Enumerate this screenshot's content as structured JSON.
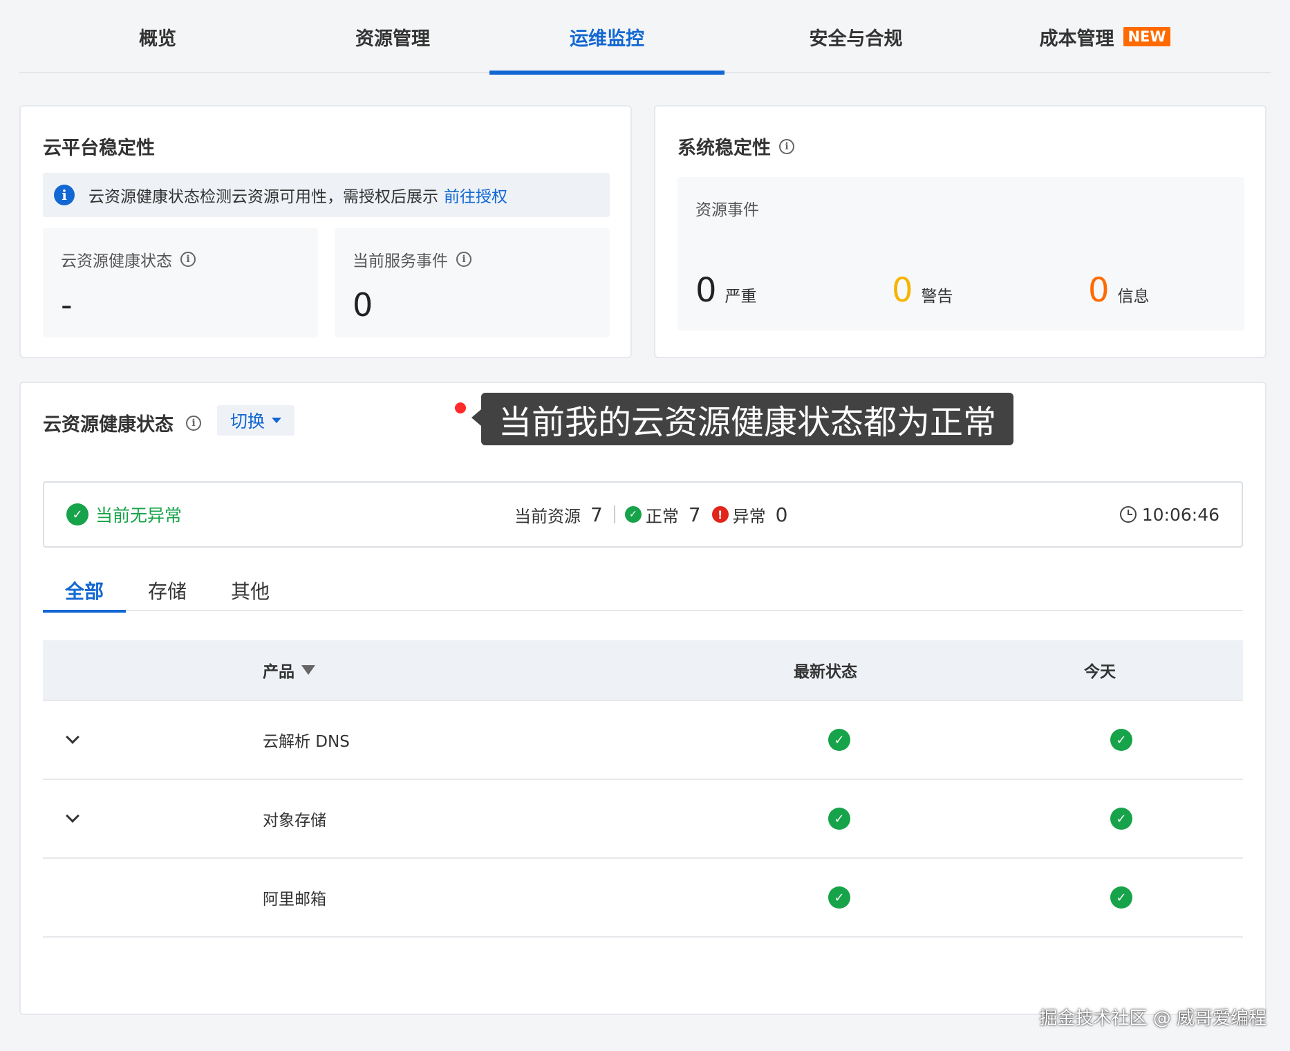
{
  "nav": {
    "tabs": [
      {
        "label": "概览"
      },
      {
        "label": "资源管理"
      },
      {
        "label": "运维监控"
      },
      {
        "label": "安全与合规"
      },
      {
        "label": "成本管理",
        "badge": "NEW"
      }
    ],
    "active_tab": "运维监控"
  },
  "platform_card": {
    "title": "云平台稳定性",
    "alert_text": "云资源健康状态检测云资源可用性，需授权后展示",
    "alert_link": "前往授权",
    "stats": [
      {
        "label": "云资源健康状态",
        "value": "-"
      },
      {
        "label": "当前服务事件",
        "value": "0"
      }
    ]
  },
  "system_card": {
    "title": "系统稳定性",
    "events_label": "资源事件",
    "events": [
      {
        "value": "0",
        "label": "严重",
        "color": "#222222"
      },
      {
        "value": "0",
        "label": "警告",
        "color": "#f5b400"
      },
      {
        "value": "0",
        "label": "信息",
        "color": "#ff6a00"
      }
    ]
  },
  "health_card": {
    "title": "云资源健康状态",
    "switch_label": "切换",
    "tooltip": "当前我的云资源健康状态都为正常",
    "status": {
      "summary": "当前无异常",
      "resources_label": "当前资源",
      "resources_count": "7",
      "normal_label": "正常",
      "normal_count": "7",
      "abnormal_label": "异常",
      "abnormal_count": "0",
      "time": "10:06:46"
    },
    "subtabs": [
      {
        "label": "全部"
      },
      {
        "label": "存储"
      },
      {
        "label": "其他"
      }
    ],
    "table": {
      "columns": [
        "产品",
        "最新状态",
        "今天"
      ],
      "rows": [
        {
          "product": "云解析 DNS",
          "expandable": true,
          "latest": "ok",
          "today": "ok"
        },
        {
          "product": "对象存储",
          "expandable": true,
          "latest": "ok",
          "today": "ok"
        },
        {
          "product": "阿里邮箱",
          "expandable": false,
          "latest": "ok",
          "today": "ok"
        }
      ]
    }
  },
  "watermark": "掘金技术社区 @ 威哥爱编程",
  "colors": {
    "accent": "#1267d2",
    "ok": "#17a34a",
    "error": "#e1251b",
    "badge": "#ff6a00"
  }
}
